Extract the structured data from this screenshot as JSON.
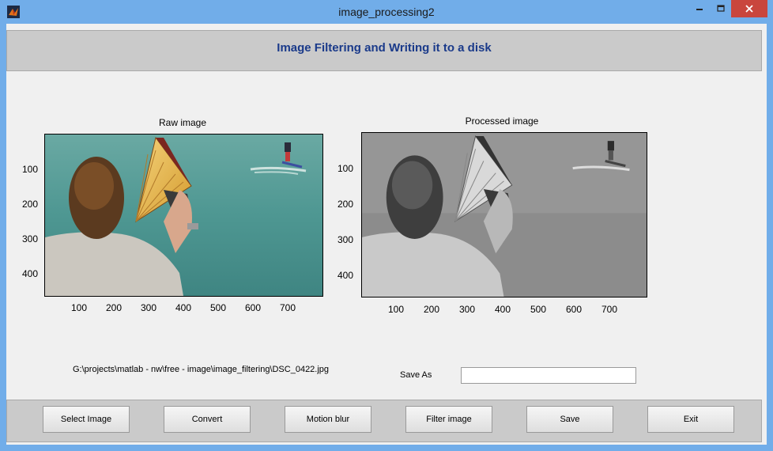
{
  "window": {
    "title": "image_processing2",
    "controls": {
      "minimize": "—",
      "maximize": "□",
      "close": "✕"
    },
    "app_icon": "matlab-icon"
  },
  "header": {
    "title": "Image Filtering and Writing it to a disk",
    "title_color": "#1a3a8a"
  },
  "raw_axes": {
    "title": "Raw image",
    "x_ticks": [
      "100",
      "200",
      "300",
      "400",
      "500",
      "600",
      "700"
    ],
    "y_ticks": [
      "100",
      "200",
      "300",
      "400"
    ]
  },
  "processed_axes": {
    "title": "Processed image",
    "x_ticks": [
      "100",
      "200",
      "300",
      "400",
      "500",
      "600",
      "700"
    ],
    "y_ticks": [
      "100",
      "200",
      "300",
      "400"
    ]
  },
  "file_path": "G:\\projects\\matlab - nw\\free - image\\image_filtering\\DSC_0422.jpg",
  "save": {
    "label": "Save As",
    "value": ""
  },
  "buttons": {
    "select_image": "Select Image",
    "convert": "Convert",
    "motion_blur": "Motion blur",
    "filter_image": "Filter image",
    "save": "Save",
    "exit": "Exit"
  }
}
